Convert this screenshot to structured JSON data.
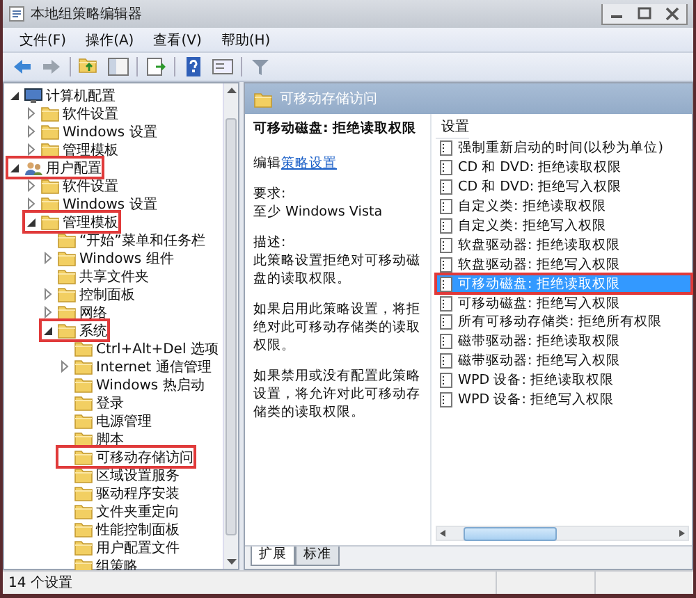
{
  "window": {
    "title": "本地组策略编辑器"
  },
  "menu": [
    "文件(F)",
    "操作(A)",
    "查看(V)",
    "帮助(H)"
  ],
  "tree": {
    "items": [
      {
        "label": "计算机配置",
        "kind": "computer",
        "expandable": true,
        "expanded": true,
        "highlighted": false,
        "children": [
          {
            "label": "软件设置",
            "kind": "folder",
            "expandable": true,
            "expanded": false,
            "highlighted": false
          },
          {
            "label": "Windows 设置",
            "kind": "folder",
            "expandable": true,
            "expanded": false,
            "highlighted": false
          },
          {
            "label": "管理模板",
            "kind": "folder",
            "expandable": true,
            "expanded": false,
            "highlighted": false
          }
        ]
      },
      {
        "label": "用户配置",
        "kind": "user",
        "expandable": true,
        "expanded": true,
        "highlighted": true,
        "children": [
          {
            "label": "软件设置",
            "kind": "folder",
            "expandable": true,
            "expanded": false,
            "highlighted": false
          },
          {
            "label": "Windows 设置",
            "kind": "folder",
            "expandable": true,
            "expanded": false,
            "highlighted": false
          },
          {
            "label": "管理模板",
            "kind": "folder",
            "expandable": true,
            "expanded": true,
            "highlighted": true,
            "children": [
              {
                "label": "“开始”菜单和任务栏",
                "kind": "folder",
                "expandable": false,
                "expanded": false,
                "highlighted": false
              },
              {
                "label": "Windows 组件",
                "kind": "folder",
                "expandable": true,
                "expanded": false,
                "highlighted": false
              },
              {
                "label": "共享文件夹",
                "kind": "folder",
                "expandable": false,
                "expanded": false,
                "highlighted": false
              },
              {
                "label": "控制面板",
                "kind": "folder",
                "expandable": true,
                "expanded": false,
                "highlighted": false
              },
              {
                "label": "网络",
                "kind": "folder",
                "expandable": true,
                "expanded": false,
                "highlighted": false
              },
              {
                "label": "系统",
                "kind": "folder",
                "expandable": true,
                "expanded": true,
                "highlighted": true,
                "children": [
                  {
                    "label": "Ctrl+Alt+Del 选项",
                    "kind": "folder",
                    "expandable": false,
                    "expanded": false,
                    "highlighted": false
                  },
                  {
                    "label": "Internet 通信管理",
                    "kind": "folder",
                    "expandable": true,
                    "expanded": false,
                    "highlighted": false
                  },
                  {
                    "label": "Windows 热启动",
                    "kind": "folder",
                    "expandable": false,
                    "expanded": false,
                    "highlighted": false
                  },
                  {
                    "label": "登录",
                    "kind": "folder",
                    "expandable": false,
                    "expanded": false,
                    "highlighted": false
                  },
                  {
                    "label": "电源管理",
                    "kind": "folder",
                    "expandable": false,
                    "expanded": false,
                    "highlighted": false
                  },
                  {
                    "label": "脚本",
                    "kind": "folder",
                    "expandable": false,
                    "expanded": false,
                    "highlighted": false
                  },
                  {
                    "label": "可移动存储访问",
                    "kind": "folder",
                    "expandable": false,
                    "expanded": false,
                    "highlighted": true
                  },
                  {
                    "label": "区域设置服务",
                    "kind": "folder",
                    "expandable": false,
                    "expanded": false,
                    "highlighted": false
                  },
                  {
                    "label": "驱动程序安装",
                    "kind": "folder",
                    "expandable": false,
                    "expanded": false,
                    "highlighted": false
                  },
                  {
                    "label": "文件夹重定向",
                    "kind": "folder",
                    "expandable": false,
                    "expanded": false,
                    "highlighted": false
                  },
                  {
                    "label": "性能控制面板",
                    "kind": "folder",
                    "expandable": false,
                    "expanded": false,
                    "highlighted": false
                  },
                  {
                    "label": "用户配置文件",
                    "kind": "folder",
                    "expandable": false,
                    "expanded": false,
                    "highlighted": false
                  },
                  {
                    "label": "组策略",
                    "kind": "folder",
                    "expandable": false,
                    "expanded": false,
                    "highlighted": false
                  }
                ]
              }
            ]
          }
        ]
      }
    ]
  },
  "header": {
    "title": "可移动存储访问"
  },
  "detail": {
    "heading": "可移动磁盘: 拒绝读取权限",
    "edit_prefix": "编辑",
    "edit_link": "策略设置",
    "requirement_label": "要求:",
    "requirement": "至少 Windows Vista",
    "description_label": "描述:",
    "paragraphs": [
      "此策略设置拒绝对可移动磁盘的读取权限。",
      "如果启用此策略设置，将拒绝对此可移动存储类的读取权限。",
      "如果禁用或没有配置此策略设置，将允许对此可移动存储类的读取权限。"
    ]
  },
  "settings": {
    "column": "设置",
    "items": [
      {
        "label": "强制重新启动的时间(以秒为单位)",
        "selected": false,
        "highlighted": false
      },
      {
        "label": "CD 和 DVD: 拒绝读取权限",
        "selected": false,
        "highlighted": false
      },
      {
        "label": "CD 和 DVD: 拒绝写入权限",
        "selected": false,
        "highlighted": false
      },
      {
        "label": "自定义类: 拒绝读取权限",
        "selected": false,
        "highlighted": false
      },
      {
        "label": "自定义类: 拒绝写入权限",
        "selected": false,
        "highlighted": false
      },
      {
        "label": "软盘驱动器: 拒绝读取权限",
        "selected": false,
        "highlighted": false
      },
      {
        "label": "软盘驱动器: 拒绝写入权限",
        "selected": false,
        "highlighted": false
      },
      {
        "label": "可移动磁盘: 拒绝读取权限",
        "selected": true,
        "highlighted": true
      },
      {
        "label": "可移动磁盘: 拒绝写入权限",
        "selected": false,
        "highlighted": false
      },
      {
        "label": "所有可移动存储类: 拒绝所有权限",
        "selected": false,
        "highlighted": false
      },
      {
        "label": "磁带驱动器: 拒绝读取权限",
        "selected": false,
        "highlighted": false
      },
      {
        "label": "磁带驱动器: 拒绝写入权限",
        "selected": false,
        "highlighted": false
      },
      {
        "label": "WPD 设备: 拒绝读取权限",
        "selected": false,
        "highlighted": false
      },
      {
        "label": "WPD 设备: 拒绝写入权限",
        "selected": false,
        "highlighted": false
      }
    ]
  },
  "tabs": [
    {
      "label": "扩展",
      "selected": true
    },
    {
      "label": "标准",
      "selected": false
    }
  ],
  "status_bar": {
    "text": "14 个设置"
  }
}
